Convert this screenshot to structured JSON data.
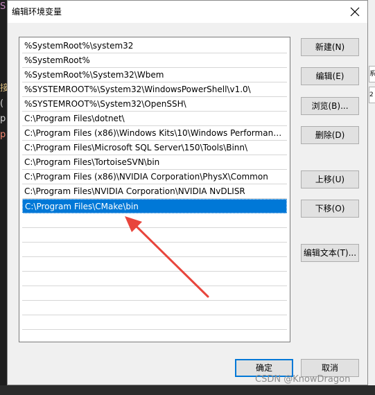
{
  "dialog": {
    "title": "编辑环境变量",
    "close_glyph": "✕"
  },
  "path_list": {
    "entries": [
      "%SystemRoot%\\system32",
      "%SystemRoot%",
      "%SystemRoot%\\System32\\Wbem",
      "%SYSTEMROOT%\\System32\\WindowsPowerShell\\v1.0\\",
      "%SYSTEMROOT%\\System32\\OpenSSH\\",
      "C:\\Program Files\\dotnet\\",
      "C:\\Program Files (x86)\\Windows Kits\\10\\Windows Performance ...",
      "C:\\Program Files\\Microsoft SQL Server\\150\\Tools\\Binn\\",
      "C:\\Program Files\\TortoiseSVN\\bin",
      "C:\\Program Files (x86)\\NVIDIA Corporation\\PhysX\\Common",
      "C:\\Program Files\\NVIDIA Corporation\\NVIDIA NvDLISR",
      "C:\\Program Files\\CMake\\bin"
    ],
    "selected_index": 11
  },
  "buttons": {
    "new": "新建(N)",
    "edit": "编辑(E)",
    "browse": "浏览(B)...",
    "delete": "删除(D)",
    "move_up": "上移(U)",
    "move_down": "下移(O)",
    "edit_text": "编辑文本(T)...",
    "ok": "确定",
    "cancel": "取消"
  },
  "annotation": {
    "arrow_color": "#e8453c"
  },
  "background": {
    "left_glyphs": [
      "S",
      "接",
      "(",
      "p",
      "p"
    ],
    "right_glyphs": [
      "系",
      "2"
    ]
  },
  "watermark": "CSDN @KnowDragon"
}
